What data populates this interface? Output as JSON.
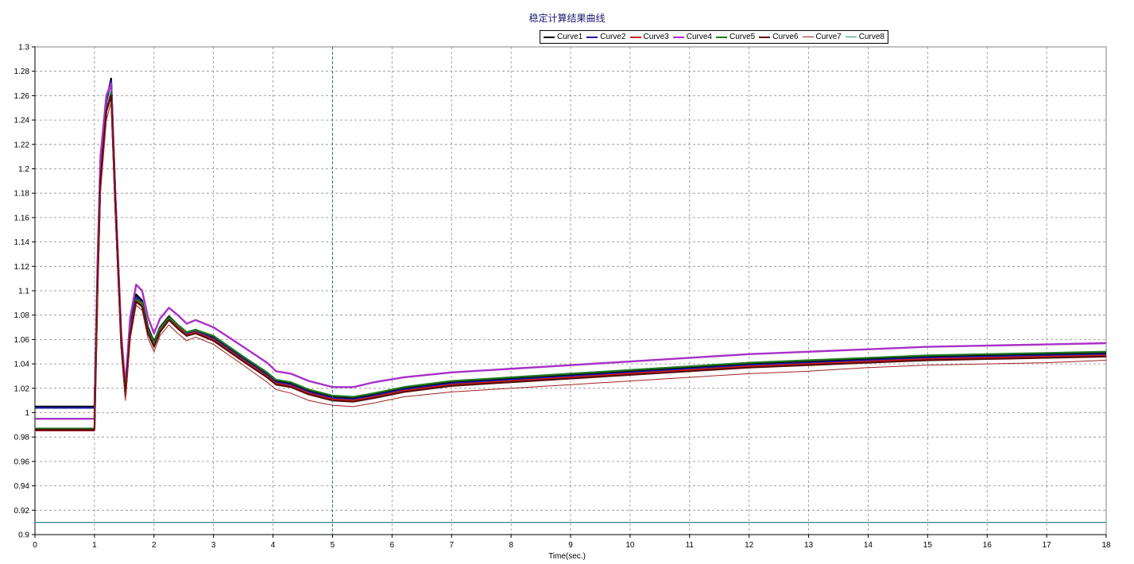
{
  "chart_data": {
    "type": "line",
    "title": "稳定计算结果曲线",
    "xlabel": "Time(sec.)",
    "ylabel": "",
    "xlim": [
      0,
      18
    ],
    "ylim": [
      0.9,
      1.3
    ],
    "x_ticks": [
      0,
      1,
      2,
      3,
      4,
      5,
      6,
      7,
      8,
      9,
      10,
      11,
      12,
      13,
      14,
      15,
      16,
      17,
      18
    ],
    "y_ticks": [
      0.9,
      0.92,
      0.94,
      0.96,
      0.98,
      1,
      1.02,
      1.04,
      1.06,
      1.08,
      1.1,
      1.12,
      1.14,
      1.16,
      1.18,
      1.2,
      1.22,
      1.24,
      1.26,
      1.28,
      1.3
    ],
    "grid": true,
    "legend_position": "top-center",
    "cursor_x": 5,
    "series": [
      {
        "name": "Curve1",
        "color": "#000000",
        "width": 2.2,
        "dash": "",
        "x": [
          0,
          0.999,
          1,
          1.05,
          1.1,
          1.2,
          1.28,
          1.35,
          1.45,
          1.52,
          1.6,
          1.7,
          1.8,
          1.9,
          2.0,
          2.1,
          2.25,
          2.4,
          2.55,
          2.7,
          3.0,
          3.5,
          3.9,
          4.05,
          4.3,
          4.6,
          5.0,
          5.35,
          5.7,
          6.2,
          7.0,
          8.0,
          9.0,
          10.0,
          11.0,
          12.0,
          13.0,
          14.0,
          15.0,
          16.0,
          17.0,
          18.0
        ],
        "y": [
          1.005,
          1.005,
          1.005,
          1.11,
          1.2,
          1.256,
          1.274,
          1.18,
          1.06,
          1.018,
          1.07,
          1.097,
          1.092,
          1.07,
          1.058,
          1.07,
          1.079,
          1.072,
          1.066,
          1.068,
          1.062,
          1.045,
          1.032,
          1.026,
          1.024,
          1.018,
          1.013,
          1.012,
          1.015,
          1.02,
          1.025,
          1.028,
          1.031,
          1.034,
          1.037,
          1.04,
          1.042,
          1.044,
          1.046,
          1.047,
          1.048,
          1.049
        ]
      },
      {
        "name": "Curve2",
        "color": "#1a1aa0",
        "width": 2.2,
        "dash": "",
        "x": [
          0,
          0.999,
          1,
          1.05,
          1.1,
          1.2,
          1.28,
          1.35,
          1.45,
          1.52,
          1.6,
          1.7,
          1.8,
          1.9,
          2.0,
          2.1,
          2.25,
          2.4,
          2.55,
          2.7,
          3.0,
          3.5,
          3.9,
          4.05,
          4.3,
          4.6,
          5.0,
          5.35,
          5.7,
          6.2,
          7.0,
          8.0,
          9.0,
          10.0,
          11.0,
          12.0,
          13.0,
          14.0,
          15.0,
          16.0,
          17.0,
          18.0
        ],
        "y": [
          1.004,
          1.004,
          1.004,
          1.11,
          1.2,
          1.255,
          1.272,
          1.18,
          1.06,
          1.017,
          1.068,
          1.095,
          1.09,
          1.068,
          1.057,
          1.069,
          1.078,
          1.071,
          1.065,
          1.067,
          1.061,
          1.044,
          1.031,
          1.025,
          1.023,
          1.017,
          1.012,
          1.011,
          1.014,
          1.019,
          1.024,
          1.027,
          1.03,
          1.033,
          1.036,
          1.039,
          1.041,
          1.043,
          1.045,
          1.046,
          1.047,
          1.048
        ]
      },
      {
        "name": "Curve3",
        "color": "#cc1f1f",
        "width": 2.0,
        "dash": "",
        "x": [
          0,
          0.999,
          1,
          1.05,
          1.1,
          1.2,
          1.28,
          1.35,
          1.45,
          1.52,
          1.6,
          1.7,
          1.8,
          1.9,
          2.0,
          2.1,
          2.25,
          2.4,
          2.55,
          2.7,
          3.0,
          3.5,
          3.9,
          4.05,
          4.3,
          4.6,
          5.0,
          5.35,
          5.7,
          6.2,
          7.0,
          8.0,
          9.0,
          10.0,
          11.0,
          12.0,
          13.0,
          14.0,
          15.0,
          16.0,
          17.0,
          18.0
        ],
        "y": [
          0.987,
          0.987,
          0.987,
          1.1,
          1.19,
          1.248,
          1.262,
          1.17,
          1.055,
          1.014,
          1.065,
          1.092,
          1.088,
          1.066,
          1.055,
          1.067,
          1.077,
          1.07,
          1.064,
          1.066,
          1.06,
          1.043,
          1.03,
          1.024,
          1.022,
          1.016,
          1.011,
          1.01,
          1.013,
          1.018,
          1.023,
          1.026,
          1.029,
          1.032,
          1.035,
          1.038,
          1.04,
          1.042,
          1.044,
          1.045,
          1.046,
          1.047
        ]
      },
      {
        "name": "Curve4",
        "color": "#a830c8",
        "width": 2.4,
        "dash": "",
        "x": [
          0,
          0.999,
          1,
          1.05,
          1.1,
          1.2,
          1.28,
          1.35,
          1.45,
          1.52,
          1.6,
          1.7,
          1.8,
          1.9,
          2.0,
          2.1,
          2.25,
          2.4,
          2.55,
          2.7,
          3.0,
          3.5,
          3.9,
          4.05,
          4.3,
          4.6,
          5.0,
          5.35,
          5.7,
          6.2,
          7.0,
          8.0,
          9.0,
          10.0,
          11.0,
          12.0,
          13.0,
          14.0,
          15.0,
          16.0,
          17.0,
          18.0
        ],
        "y": [
          0.995,
          0.995,
          0.995,
          1.12,
          1.21,
          1.26,
          1.27,
          1.18,
          1.065,
          1.022,
          1.078,
          1.105,
          1.1,
          1.078,
          1.065,
          1.077,
          1.086,
          1.08,
          1.073,
          1.076,
          1.07,
          1.054,
          1.041,
          1.034,
          1.032,
          1.026,
          1.021,
          1.021,
          1.025,
          1.029,
          1.033,
          1.036,
          1.039,
          1.042,
          1.045,
          1.048,
          1.05,
          1.052,
          1.054,
          1.055,
          1.056,
          1.057
        ]
      },
      {
        "name": "Curve5",
        "color": "#1e7a1e",
        "width": 2.2,
        "dash": "",
        "x": [
          0,
          0.999,
          1,
          1.05,
          1.1,
          1.2,
          1.28,
          1.35,
          1.45,
          1.52,
          1.6,
          1.7,
          1.8,
          1.9,
          2.0,
          2.1,
          2.25,
          2.4,
          2.55,
          2.7,
          3.0,
          3.5,
          3.9,
          4.05,
          4.3,
          4.6,
          5.0,
          5.35,
          5.7,
          6.2,
          7.0,
          8.0,
          9.0,
          10.0,
          11.0,
          12.0,
          13.0,
          14.0,
          15.0,
          16.0,
          17.0,
          18.0
        ],
        "y": [
          0.987,
          0.987,
          0.987,
          1.1,
          1.19,
          1.248,
          1.263,
          1.17,
          1.056,
          1.016,
          1.066,
          1.093,
          1.09,
          1.068,
          1.057,
          1.069,
          1.078,
          1.072,
          1.066,
          1.068,
          1.063,
          1.046,
          1.033,
          1.027,
          1.025,
          1.019,
          1.014,
          1.013,
          1.016,
          1.021,
          1.026,
          1.029,
          1.032,
          1.035,
          1.038,
          1.041,
          1.043,
          1.045,
          1.047,
          1.048,
          1.049,
          1.05
        ]
      },
      {
        "name": "Curve6",
        "color": "#5a0a0a",
        "width": 2.2,
        "dash": "",
        "x": [
          0,
          0.999,
          1,
          1.05,
          1.1,
          1.2,
          1.28,
          1.35,
          1.45,
          1.52,
          1.6,
          1.7,
          1.8,
          1.9,
          2.0,
          2.1,
          2.25,
          2.4,
          2.55,
          2.7,
          3.0,
          3.5,
          3.9,
          4.05,
          4.3,
          4.6,
          5.0,
          5.35,
          5.7,
          6.2,
          7.0,
          8.0,
          9.0,
          10.0,
          11.0,
          12.0,
          13.0,
          14.0,
          15.0,
          16.0,
          17.0,
          18.0
        ],
        "y": [
          0.986,
          0.986,
          0.986,
          1.1,
          1.19,
          1.247,
          1.26,
          1.17,
          1.055,
          1.014,
          1.064,
          1.091,
          1.087,
          1.065,
          1.054,
          1.066,
          1.076,
          1.069,
          1.063,
          1.065,
          1.059,
          1.042,
          1.029,
          1.023,
          1.021,
          1.015,
          1.01,
          1.009,
          1.012,
          1.017,
          1.022,
          1.025,
          1.028,
          1.031,
          1.034,
          1.037,
          1.039,
          1.041,
          1.043,
          1.044,
          1.045,
          1.046
        ]
      },
      {
        "name": "Curve7",
        "color": "#a02020",
        "width": 1.0,
        "dash": "",
        "x": [
          0,
          0.999,
          1,
          1.05,
          1.1,
          1.2,
          1.28,
          1.35,
          1.45,
          1.52,
          1.6,
          1.7,
          1.8,
          1.9,
          2.0,
          2.1,
          2.25,
          2.4,
          2.55,
          2.7,
          3.0,
          3.5,
          3.9,
          4.05,
          4.3,
          4.6,
          5.0,
          5.35,
          5.7,
          6.2,
          7.0,
          8.0,
          9.0,
          10.0,
          11.0,
          12.0,
          13.0,
          14.0,
          15.0,
          16.0,
          17.0,
          18.0
        ],
        "y": [
          0.985,
          0.985,
          0.985,
          1.09,
          1.18,
          1.24,
          1.255,
          1.16,
          1.05,
          1.01,
          1.06,
          1.088,
          1.084,
          1.061,
          1.05,
          1.063,
          1.072,
          1.065,
          1.059,
          1.062,
          1.056,
          1.039,
          1.025,
          1.019,
          1.016,
          1.01,
          1.006,
          1.005,
          1.008,
          1.013,
          1.017,
          1.02,
          1.023,
          1.026,
          1.029,
          1.032,
          1.034,
          1.037,
          1.039,
          1.04,
          1.041,
          1.043
        ]
      },
      {
        "name": "Curve8",
        "color": "#2a8a8a",
        "width": 1.2,
        "dash": "",
        "x": [
          0,
          18
        ],
        "y": [
          0.91,
          0.91
        ]
      }
    ]
  }
}
